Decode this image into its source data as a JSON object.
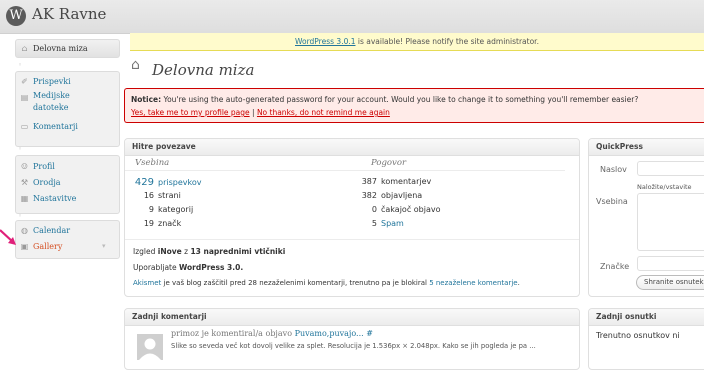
{
  "site": {
    "title": "AK Ravne"
  },
  "update_nag": {
    "link": "WordPress 3.0.1",
    "text": " is available! Please notify the site administrator."
  },
  "sidebar": {
    "items": [
      {
        "label": "Delovna miza",
        "icon": "home-icon"
      },
      {
        "label": "Prispevki",
        "icon": "pin-icon"
      },
      {
        "label": "Medijske",
        "label2": "datoteke",
        "icon": "media-icon"
      },
      {
        "label": "Komentarji",
        "icon": "comment-icon"
      },
      {
        "label": "Profil",
        "icon": "users-icon"
      },
      {
        "label": "Orodja",
        "icon": "tools-icon"
      },
      {
        "label": "Nastavitve",
        "icon": "settings-icon"
      },
      {
        "label": "Calendar",
        "icon": "calendar-icon"
      },
      {
        "label": "Gallery",
        "icon": "gallery-icon"
      }
    ],
    "arrow_color": "#e0207a"
  },
  "page": {
    "title": "Delovna miza"
  },
  "notice": {
    "bold": "Notice:",
    "text": " You're using the auto-generated password for your account. Would you like to change it to something you'll remember easier?",
    "link1": "Yes, take me to my profile page",
    "sep": " | ",
    "link2": "No thanks, do not remind me again"
  },
  "right_now": {
    "title": "Hitre povezave",
    "content_head": "Vsebina",
    "discussion_head": "Pogovor",
    "content": [
      {
        "num": "429",
        "label": "prispevkov"
      },
      {
        "num": "16",
        "label": "strani"
      },
      {
        "num": "9",
        "label": "kategorij"
      },
      {
        "num": "19",
        "label": "značk"
      }
    ],
    "discussion": [
      {
        "num": "387",
        "label": "komentarjev"
      },
      {
        "num": "382",
        "label": "objavljena"
      },
      {
        "num": "0",
        "label": "čakajoč objavo"
      },
      {
        "num": "5",
        "label": "Spam"
      }
    ],
    "theme_pre": "Izgled ",
    "theme_bold": "iNove",
    "theme_mid": " z ",
    "theme_bold2": "13 naprednimi vtičniki",
    "version_pre": "Uporabljate ",
    "version_bold": "WordPress 3.0.",
    "akismet_link": "Akismet",
    "akismet_text": " je vaš blog zaščitil pred 28 nezaželenimi komentarji, trenutno pa je blokiral ",
    "akismet_link2": "5 nezaželene komentarje",
    "akismet_end": "."
  },
  "quickpress": {
    "title": "QuickPress",
    "naslov": "Naslov",
    "upload": "Naložite/vstavite",
    "vsebina": "Vsebina",
    "znacke": "Značke",
    "button": "Shranite osnutek"
  },
  "recent_comments": {
    "title": "Zadnji komentarji",
    "author": "primoz",
    "mid": " je komentiral/a objavo ",
    "post": "Puvamo,puvajo...",
    "hash": " #",
    "excerpt": "Slike so seveda več kot dovolj velike za splet. Resolucija je 1.536px × 2.048px. Kako se jih pogleda je pa ..."
  },
  "recent_drafts": {
    "title": "Zadnji osnutki",
    "text": "Trenutno osnutkov ni"
  }
}
